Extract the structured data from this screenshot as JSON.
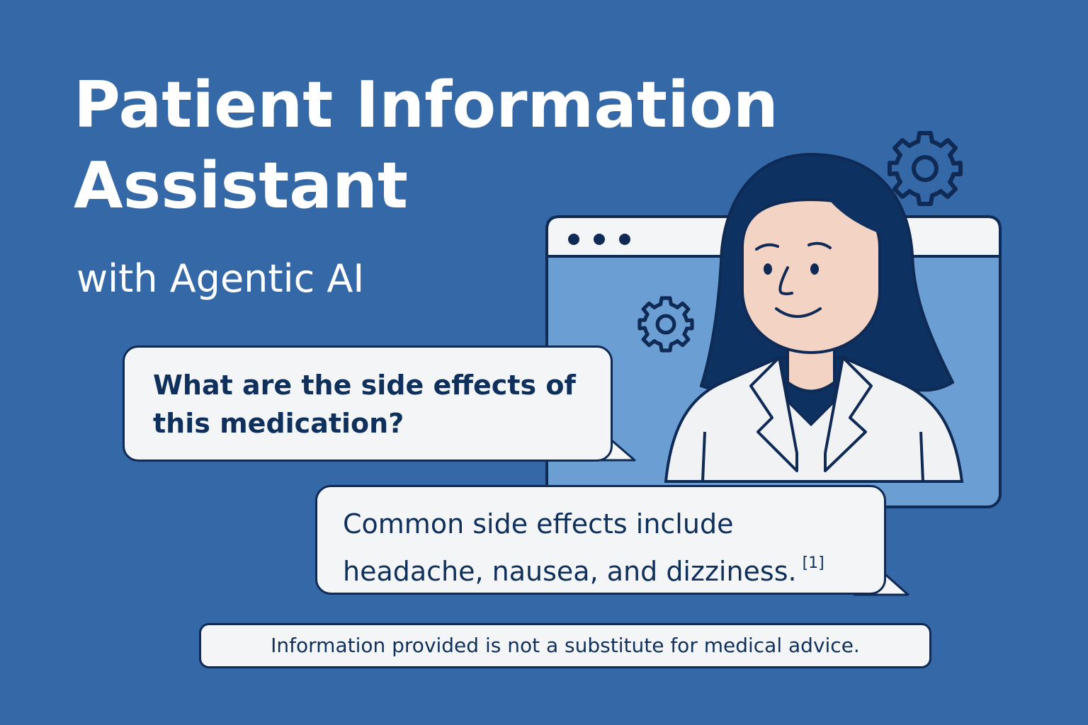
{
  "title": {
    "line1": "Patient Information",
    "line2": "Assistant"
  },
  "subtitle": "with Agentic AI",
  "chat": {
    "question": "What are the side effects of this medication?",
    "answer": "Common side effects include headache, nausea, and dizziness.",
    "citation": "[1]"
  },
  "disclaimer": "Information provided is not a substitute for medical advice.",
  "icons": [
    "gear-icon",
    "browser-window",
    "doctor-avatar"
  ],
  "colors": {
    "background": "#3568a6",
    "outline": "#0f2a54",
    "bubble_fill": "#f4f5f7",
    "window_inner": "#6b9fd4",
    "hair": "#0d3160",
    "skin": "#f2d3c4",
    "coat": "#f1f2f4"
  }
}
